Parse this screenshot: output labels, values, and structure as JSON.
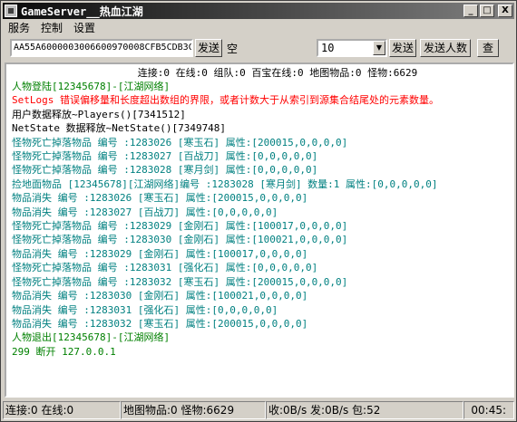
{
  "window": {
    "title": "GameServer__热血江湖"
  },
  "title_buttons": {
    "minimize": "_",
    "maximize": "□",
    "close": "X"
  },
  "menu": {
    "items": [
      "服务",
      "控制",
      "设置"
    ]
  },
  "toolbar": {
    "packet_value": "AA55A6000003006600970008CFB5CDB3C",
    "send_label": "发送",
    "empty_label": "空",
    "count_value": "10",
    "send2_label": "发送",
    "send_count_label": "发送人数",
    "query_label": "查"
  },
  "log": {
    "header": "连接:0 在线:0 组队:0 百宝在线:0 地图物品:0 怪物:6629",
    "lines": [
      {
        "text": "人物登陆[12345678]-[江湖网络]",
        "color": "#008000"
      },
      {
        "text": "SetLogs 错误偏移量和长度超出数组的界限，或者计数大于从索引到源集合结尾处的元素数量。",
        "color": "#ff0000"
      },
      {
        "text": "用户数据释放~Players()[7341512]",
        "color": "#000000"
      },
      {
        "text": "NetState 数据释放~NetState()[7349748]",
        "color": "#000000"
      },
      {
        "text": "怪物死亡掉落物品 编号 :1283026 [寒玉石] 属性:[200015,0,0,0,0]",
        "color": "#008080"
      },
      {
        "text": "怪物死亡掉落物品 编号 :1283027 [百战刀] 属性:[0,0,0,0,0]",
        "color": "#008080"
      },
      {
        "text": "怪物死亡掉落物品 编号 :1283028 [寒月剑] 属性:[0,0,0,0,0]",
        "color": "#008080"
      },
      {
        "text": "捡地面物品 [12345678][江湖网络]编号 :1283028 [寒月剑] 数量:1 属性:[0,0,0,0,0]",
        "color": "#008080"
      },
      {
        "text": "物品消失       编号 :1283026 [寒玉石] 属性:[200015,0,0,0,0]",
        "color": "#008080"
      },
      {
        "text": "物品消失       编号 :1283027 [百战刀] 属性:[0,0,0,0,0]",
        "color": "#008080"
      },
      {
        "text": "怪物死亡掉落物品 编号 :1283029 [金刚石] 属性:[100017,0,0,0,0]",
        "color": "#008080"
      },
      {
        "text": "怪物死亡掉落物品 编号 :1283030 [金刚石] 属性:[100021,0,0,0,0]",
        "color": "#008080"
      },
      {
        "text": "物品消失       编号 :1283029 [金刚石] 属性:[100017,0,0,0,0]",
        "color": "#008080"
      },
      {
        "text": "怪物死亡掉落物品 编号 :1283031 [强化石] 属性:[0,0,0,0,0]",
        "color": "#008080"
      },
      {
        "text": "怪物死亡掉落物品 编号 :1283032 [寒玉石] 属性:[200015,0,0,0,0]",
        "color": "#008080"
      },
      {
        "text": "物品消失       编号 :1283030 [金刚石] 属性:[100021,0,0,0,0]",
        "color": "#008080"
      },
      {
        "text": "物品消失       编号 :1283031 [强化石] 属性:[0,0,0,0,0]",
        "color": "#008080"
      },
      {
        "text": "物品消失       编号 :1283032 [寒玉石] 属性:[200015,0,0,0,0]",
        "color": "#008080"
      },
      {
        "text": "人物退出[12345678]-[江湖网络]",
        "color": "#008000"
      },
      {
        "text": "299 断开 127.0.0.1",
        "color": "#008000"
      }
    ]
  },
  "status": {
    "connection": "连接:0 在线:0",
    "map": "地图物品:0 怪物:6629",
    "traffic": "收:0B/s 发:0B/s 包:52",
    "time": "00:45:"
  }
}
